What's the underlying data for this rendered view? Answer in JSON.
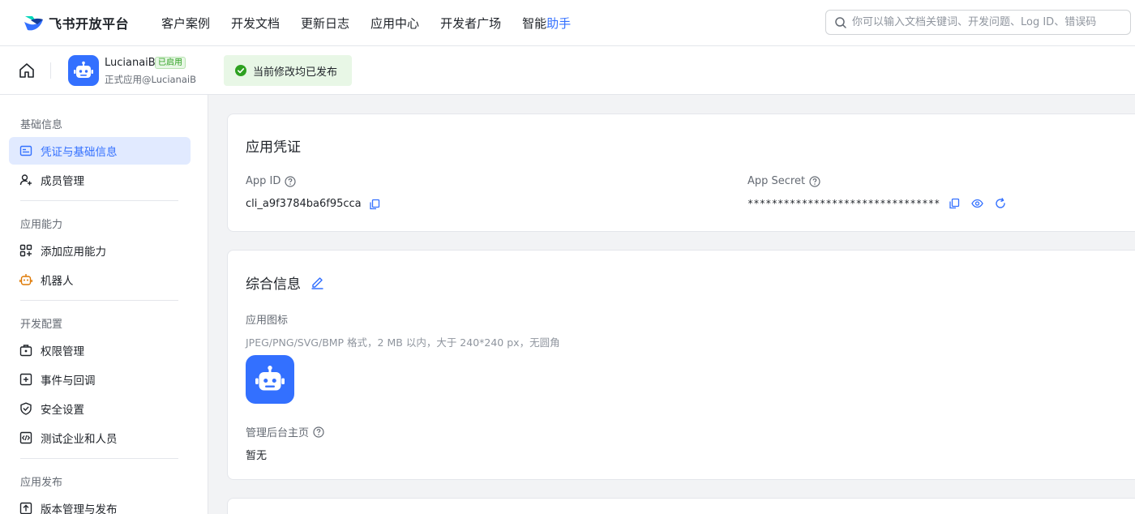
{
  "topnav": {
    "logo_text": "飞书开放平台",
    "items": [
      {
        "label": "客户案例"
      },
      {
        "label": "开发文档"
      },
      {
        "label": "更新日志"
      },
      {
        "label": "应用中心"
      },
      {
        "label": "开发者广场"
      }
    ],
    "assistant_label_prefix": "智能",
    "assistant_label_accent": "助手",
    "search_placeholder": "你可以输入文档关键词、开发问题、Log ID、错误码"
  },
  "app_header": {
    "app_name": "LucianaiB",
    "status_badge": "已启用",
    "subtitle": "正式应用@LucianaiB",
    "publish_status": "当前修改均已发布"
  },
  "sidebar": {
    "sections": [
      {
        "title": "基础信息",
        "items": [
          {
            "label": "凭证与基础信息",
            "icon": "id-card-icon",
            "active": true
          },
          {
            "label": "成员管理",
            "icon": "user-add-icon",
            "active": false
          }
        ]
      },
      {
        "title": "应用能力",
        "items": [
          {
            "label": "添加应用能力",
            "icon": "add-grid-icon",
            "active": false
          },
          {
            "label": "机器人",
            "icon": "robot-icon",
            "active": false
          }
        ]
      },
      {
        "title": "开发配置",
        "items": [
          {
            "label": "权限管理",
            "icon": "permission-icon",
            "active": false
          },
          {
            "label": "事件与回调",
            "icon": "event-icon",
            "active": false
          },
          {
            "label": "安全设置",
            "icon": "shield-icon",
            "active": false
          },
          {
            "label": "测试企业和人员",
            "icon": "code-icon",
            "active": false
          }
        ]
      },
      {
        "title": "应用发布",
        "items": [
          {
            "label": "版本管理与发布",
            "icon": "upload-icon",
            "active": false
          }
        ]
      }
    ]
  },
  "credentials": {
    "title": "应用凭证",
    "app_id_label": "App ID",
    "app_id_value": "cli_a9f3784ba6f95cca",
    "app_secret_label": "App Secret",
    "app_secret_value": "********************************"
  },
  "general_info": {
    "title": "综合信息",
    "icon_label": "应用图标",
    "icon_hint": "JPEG/PNG/SVG/BMP 格式，2 MB 以内，大于 240*240 px，无圆角",
    "admin_home_label": "管理后台主页",
    "admin_home_value": "暂无"
  },
  "colors": {
    "accent": "#3370ff",
    "success": "#2ea121",
    "robot_orange": "#de7802"
  }
}
